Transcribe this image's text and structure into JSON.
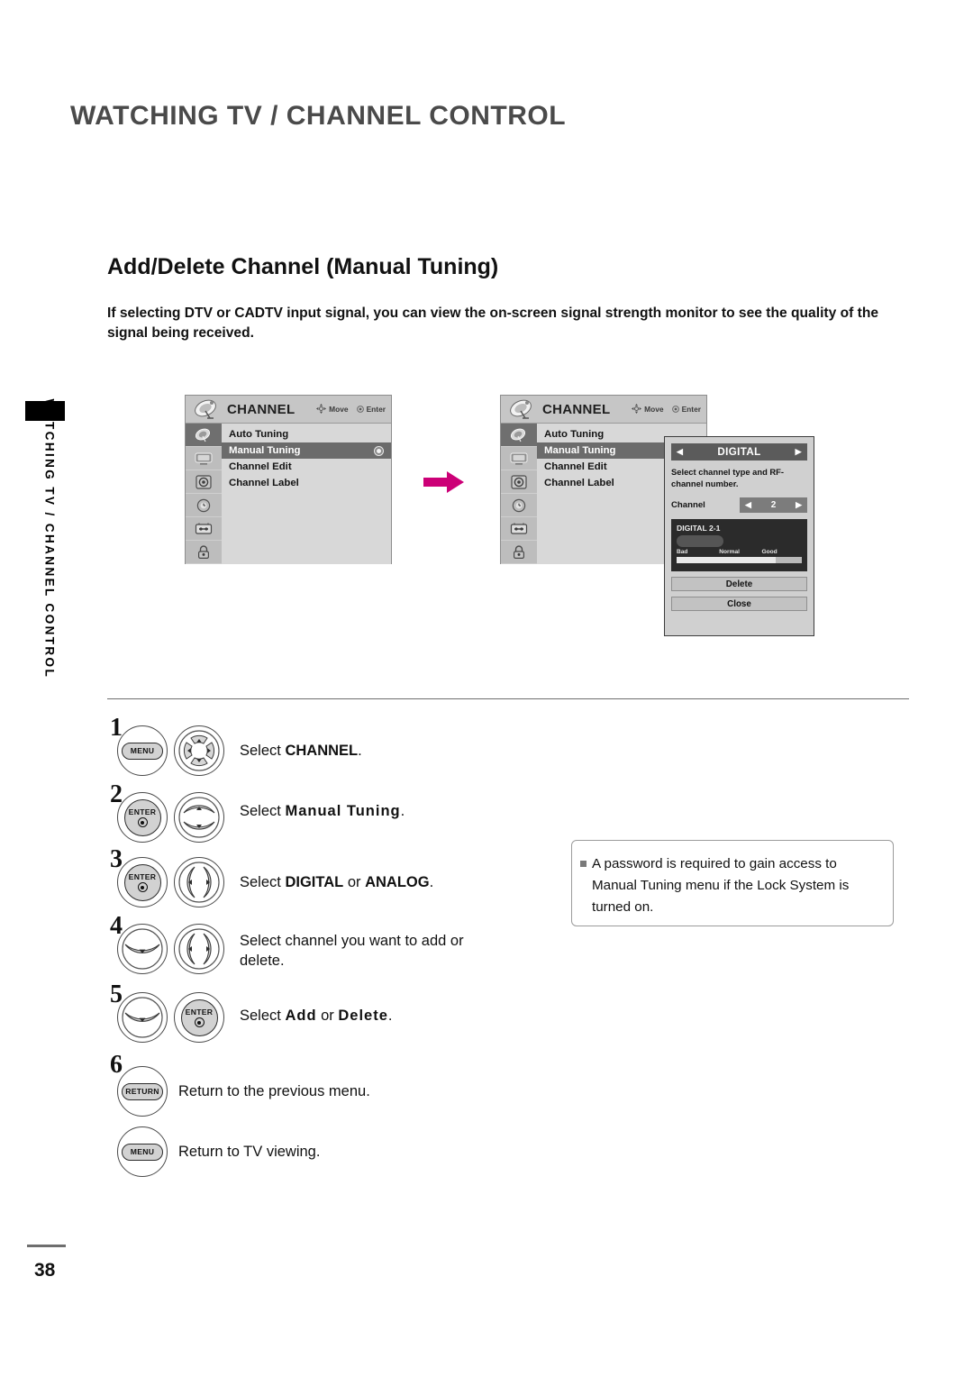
{
  "page": {
    "header_title": "WATCHING TV / CHANNEL CONTROL",
    "side_tab_text": "WATCHING TV / CHANNEL CONTROL",
    "page_number": "38",
    "accent_arrow_color": "#CC0077"
  },
  "section": {
    "heading": "Add/Delete Channel (Manual Tuning)",
    "intro": "If selecting DTV or CADTV input signal, you can view the on-screen signal strength monitor to see the quality of the signal being received."
  },
  "osd": {
    "title": "CHANNEL",
    "hints": [
      {
        "icon": "dpad-icon",
        "label": "Move"
      },
      {
        "icon": "enter-dot-icon",
        "label": "Enter"
      }
    ],
    "rail_icons": [
      "satellite-dish-icon",
      "picture-tv-icon",
      "audio-speaker-icon",
      "time-clock-icon",
      "setup-option-icon",
      "lock-padlock-icon"
    ],
    "menu_items": [
      {
        "label": "Auto Tuning",
        "selected": false,
        "radio": false
      },
      {
        "label": "Manual Tuning",
        "selected": true,
        "radio": true
      },
      {
        "label": "Channel Edit",
        "selected": false,
        "radio": false
      },
      {
        "label": "Channel Label",
        "selected": false,
        "radio": false
      }
    ]
  },
  "digital_dialog": {
    "title": "DIGITAL",
    "left_arrow": "◀",
    "right_arrow": "▶",
    "description": "Select channel type and RF-channel number.",
    "channel_label": "Channel",
    "channel_value": "2",
    "signal": {
      "name": "DIGITAL 2-1",
      "scale": [
        "Bad",
        "Normal",
        "Good"
      ],
      "bar_fill_percent": 79
    },
    "buttons": [
      {
        "label": "Delete"
      },
      {
        "label": "Close"
      }
    ]
  },
  "steps": [
    {
      "num": "1",
      "buttons": [
        "MENU",
        "dpad-wheel"
      ],
      "text_pre": "Select ",
      "text_bold": "CHANNEL",
      "text_post": "."
    },
    {
      "num": "2",
      "buttons": [
        "ENTER",
        "up-down-rocker"
      ],
      "text_pre": "Select ",
      "text_bold": "Manual Tuning",
      "text_post": "."
    },
    {
      "num": "3",
      "buttons": [
        "ENTER",
        "left-right-rocker"
      ],
      "text_pre": "Select ",
      "text_bold": "DIGITAL",
      "text_mid": " or ",
      "text_bold2": "ANALOG",
      "text_post": "."
    },
    {
      "num": "4",
      "buttons": [
        "down-rocker",
        "left-right-rocker"
      ],
      "text_plain": "Select channel you want to add or delete."
    },
    {
      "num": "5",
      "buttons": [
        "down-rocker",
        "ENTER"
      ],
      "text_pre": "Select ",
      "text_bold": "Add",
      "text_mid": " or ",
      "text_bold2": "Delete",
      "text_post": "."
    },
    {
      "num": "6",
      "buttons": [
        "RETURN"
      ],
      "text_plain": "Return to the previous menu."
    },
    {
      "num": "",
      "buttons": [
        "MENU"
      ],
      "text_plain": "Return to TV viewing."
    }
  ],
  "button_labels": {
    "menu": "MENU",
    "enter": "ENTER",
    "return": "RETURN"
  },
  "note": {
    "bullet": "square-bullet-icon",
    "text": "A password is required to gain access to Manual Tuning menu if the Lock System is turned on."
  }
}
